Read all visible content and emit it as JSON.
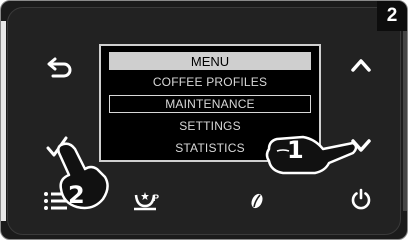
{
  "badge": "2",
  "menu": {
    "title": "MENU",
    "items": [
      "COFFEE PROFILES",
      "MAINTENANCE",
      "SETTINGS",
      "STATISTICS"
    ],
    "selected_index": 1
  },
  "callouts": {
    "first": "1",
    "second": "2"
  },
  "icons": {
    "back": "back-arrow-icon",
    "up": "chevron-up-icon",
    "down": "chevron-down-icon",
    "ok": "check-icon",
    "list": "list-icon",
    "favorites": "cup-star-icon",
    "bean": "coffee-bean-icon",
    "power": "power-icon"
  }
}
